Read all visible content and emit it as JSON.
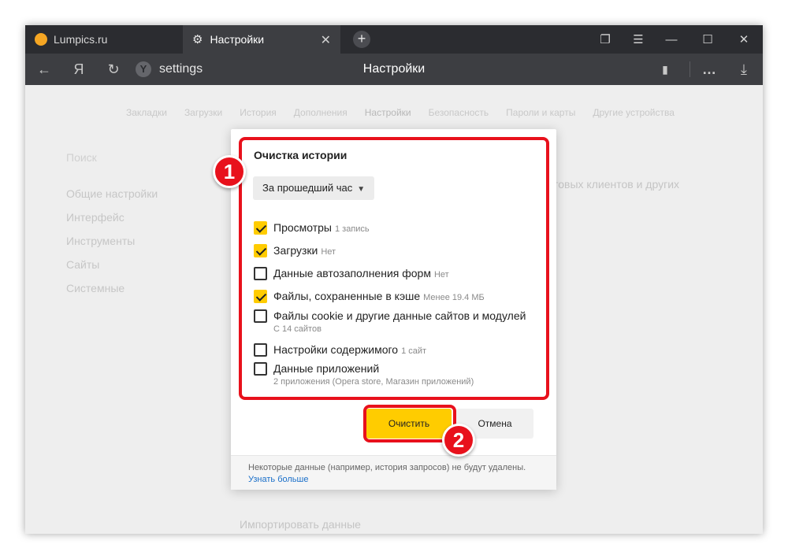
{
  "tabs": [
    {
      "label": "Lumpics.ru",
      "icon": "orange-circle-favicon"
    },
    {
      "label": "Настройки",
      "icon": "gear-icon"
    }
  ],
  "address": {
    "url": "settings",
    "logo_letter": "Я",
    "page_title": "Настройки"
  },
  "page_nav": [
    "Закладки",
    "Загрузки",
    "История",
    "Дополнения",
    "Настройки",
    "Безопасность",
    "Пароли и карты",
    "Другие устройства"
  ],
  "sidebar": {
    "search": "Поиск",
    "items": [
      "Общие настройки",
      "Интерфейс",
      "Инструменты",
      "Сайты",
      "Системные"
    ]
  },
  "background": {
    "right_text": "товых клиентов и других",
    "import_link": "Импортировать данные"
  },
  "dialog": {
    "title": "Очистка истории",
    "period": "За прошедший час",
    "options": [
      {
        "label": "Просмотры",
        "meta": "1 запись",
        "checked": true
      },
      {
        "label": "Загрузки",
        "meta": "Нет",
        "checked": true
      },
      {
        "label": "Данные автозаполнения форм",
        "meta": "Нет",
        "checked": false
      },
      {
        "label": "Файлы, сохраненные в кэше",
        "meta": "Менее 19.4 МБ",
        "checked": true
      },
      {
        "label": "Файлы cookie и другие данные сайтов и модулей",
        "sub": "С 14 сайтов",
        "checked": false
      },
      {
        "label": "Настройки содержимого",
        "meta": "1 сайт",
        "checked": false
      },
      {
        "label": "Данные приложений",
        "sub": "2 приложения (Opera store, Магазин приложений)",
        "checked": false
      }
    ],
    "clear_button": "Очистить",
    "cancel_button": "Отмена",
    "footer_note": "Некоторые данные (например, история запросов) не будут удалены.",
    "footer_link": "Узнать больше"
  },
  "annotations": [
    "1",
    "2"
  ],
  "colors": {
    "accent": "#ffcc00",
    "annotation": "#e8111c",
    "titlebar": "#2b2c30",
    "addressbar": "#3d3e42"
  }
}
